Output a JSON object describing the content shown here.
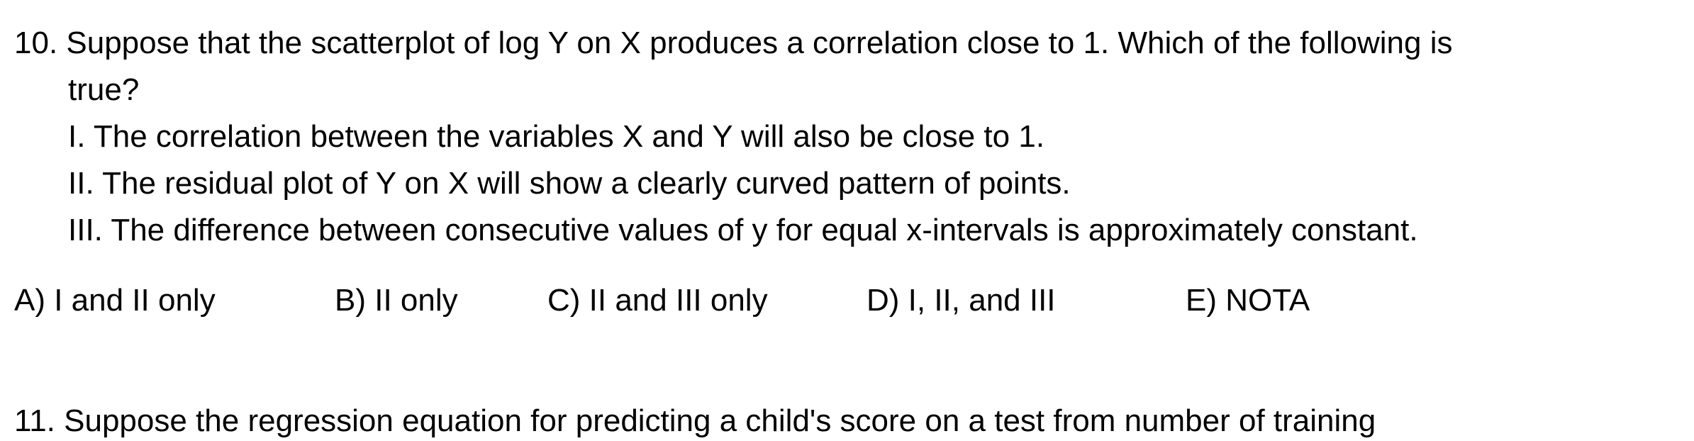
{
  "question": {
    "stem_line1": "10. Suppose that the scatterplot of log Y on X produces a correlation close to 1. Which of the following is",
    "stem_line2": "true?",
    "statements": [
      "I. The correlation between the variables X and Y will also be close to 1.",
      "II. The residual plot of Y on X will show a clearly curved pattern of points.",
      "III. The difference between consecutive values of y for equal x-intervals is approximately constant."
    ],
    "choices": [
      "A) I and II only",
      "B) II only",
      "C) II and III only",
      "D) I, II, and III",
      "E) NOTA"
    ]
  },
  "next_question_partial": "11. Suppose the regression equation for predicting a child's score on a test from number of training"
}
